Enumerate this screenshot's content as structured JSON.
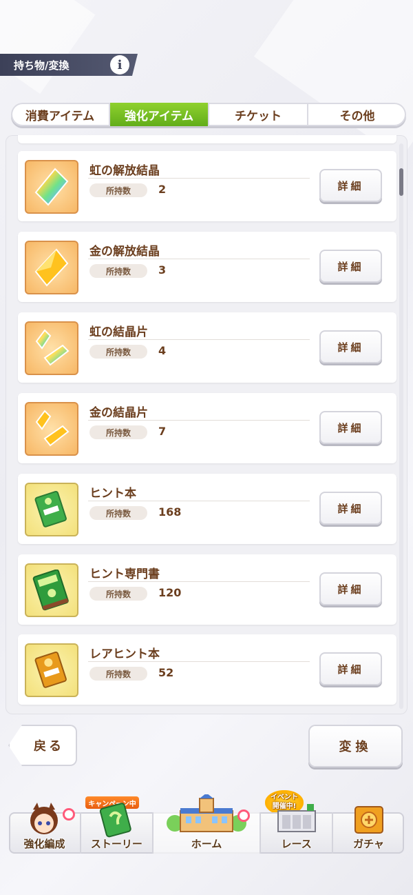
{
  "header": {
    "title": "持ち物/変換",
    "info_symbol": "i"
  },
  "tabs": [
    {
      "label": "消費アイテム",
      "active": false
    },
    {
      "label": "強化アイテム",
      "active": true
    },
    {
      "label": "チケット",
      "active": false
    },
    {
      "label": "その他",
      "active": false
    }
  ],
  "items": [
    {
      "name": "虹の解放結晶",
      "qty_label": "所持数",
      "qty": "2",
      "detail": "詳細",
      "icon": "rainbow-crystal-icon"
    },
    {
      "name": "金の解放結晶",
      "qty_label": "所持数",
      "qty": "3",
      "detail": "詳細",
      "icon": "gold-crystal-icon"
    },
    {
      "name": "虹の結晶片",
      "qty_label": "所持数",
      "qty": "4",
      "detail": "詳細",
      "icon": "rainbow-shard-icon"
    },
    {
      "name": "金の結晶片",
      "qty_label": "所持数",
      "qty": "7",
      "detail": "詳細",
      "icon": "gold-shard-icon"
    },
    {
      "name": "ヒント本",
      "qty_label": "所持数",
      "qty": "168",
      "detail": "詳細",
      "icon": "hint-book-icon"
    },
    {
      "name": "ヒント専門書",
      "qty_label": "所持数",
      "qty": "120",
      "detail": "詳細",
      "icon": "hint-expert-book-icon"
    },
    {
      "name": "レアヒント本",
      "qty_label": "所持数",
      "qty": "52",
      "detail": "詳細",
      "icon": "rare-hint-book-icon"
    }
  ],
  "buttons": {
    "back": "戻る",
    "convert": "変換"
  },
  "nav": {
    "items": [
      {
        "label": "強化編成"
      },
      {
        "label": "ストーリー"
      },
      {
        "label": "ホーム"
      },
      {
        "label": "レース"
      },
      {
        "label": "ガチャ"
      }
    ],
    "campaign_badge": "キャンペーン中",
    "event_badge_line1": "イベント",
    "event_badge_line2": "開催中!"
  },
  "colors": {
    "active_tab": "#7cc025",
    "text_brown": "#6b3e1e",
    "header_bg": "#3c4058"
  }
}
